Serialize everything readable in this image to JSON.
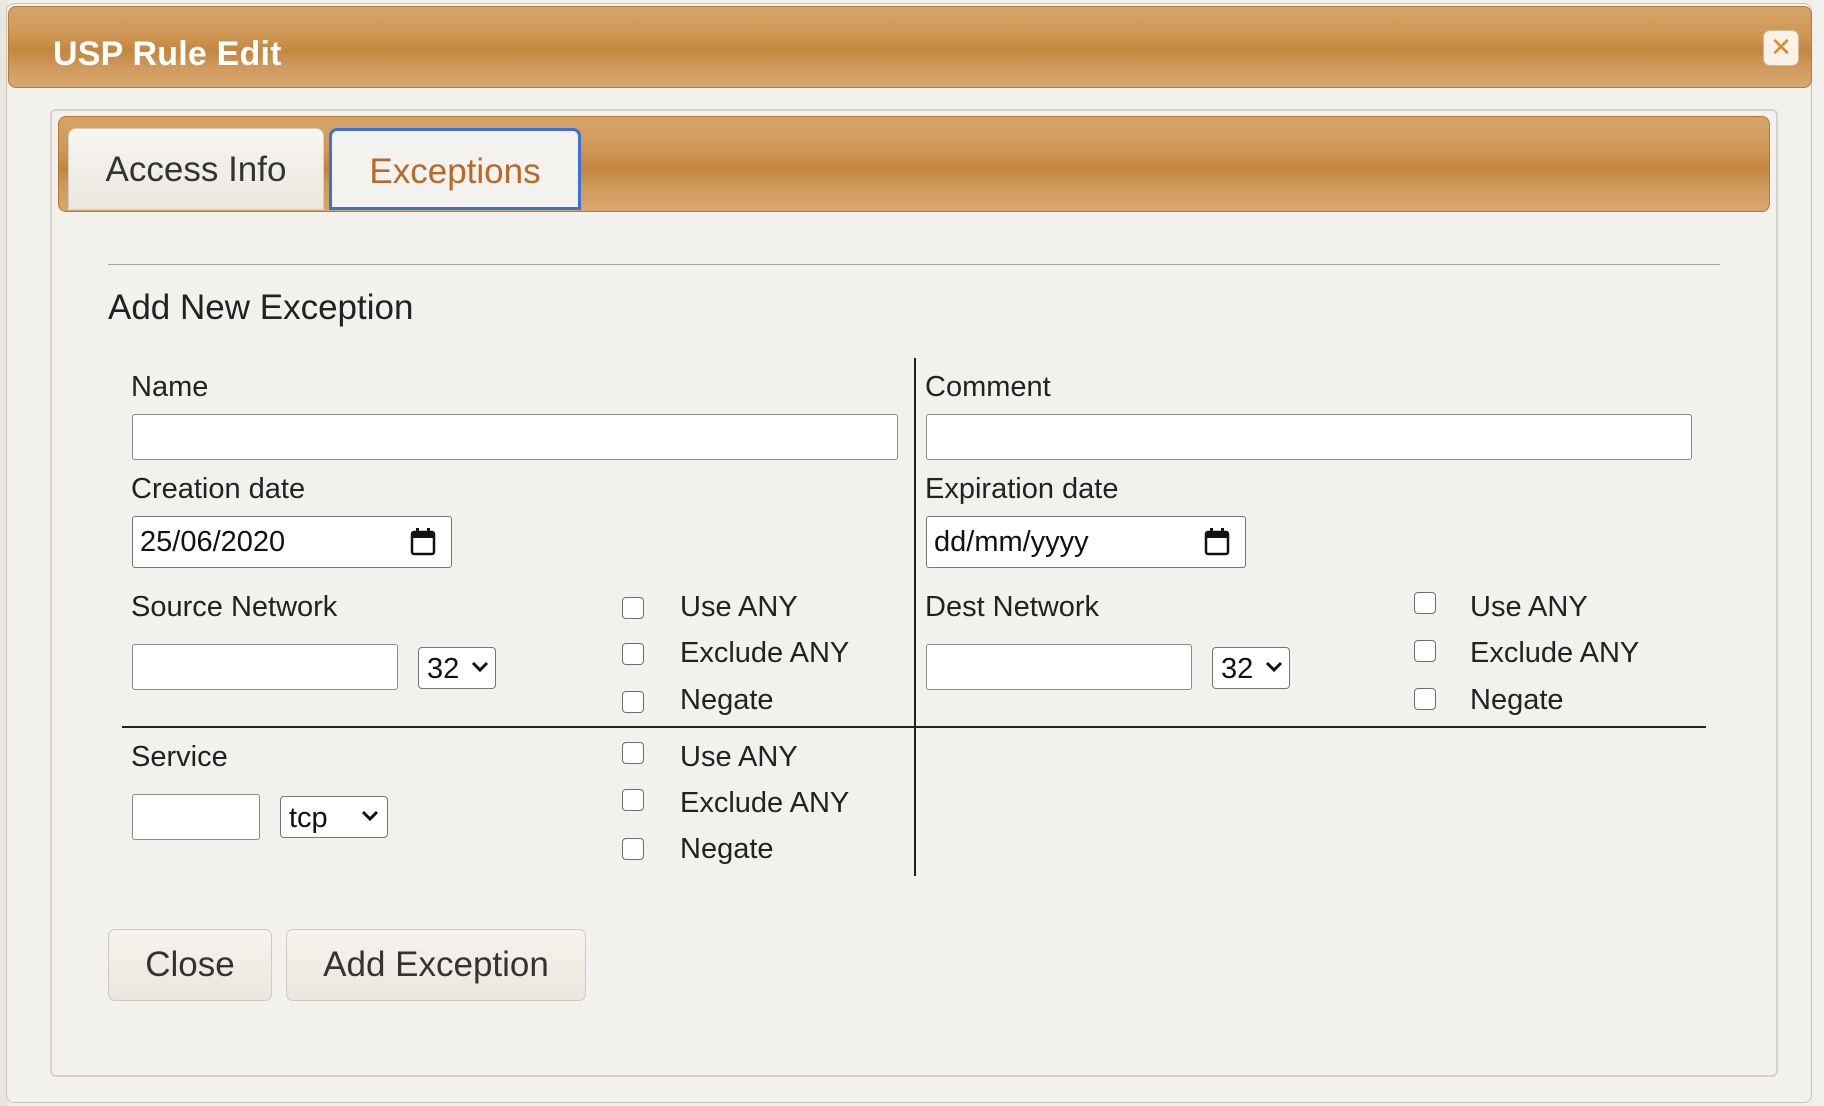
{
  "dialog": {
    "title": "USP Rule Edit",
    "close_icon": "close-x-icon",
    "accent_color": "#c88a45"
  },
  "tabs": [
    {
      "label": "Access Info",
      "active": false
    },
    {
      "label": "Exceptions",
      "active": true
    }
  ],
  "section": {
    "heading": "Add New Exception"
  },
  "form": {
    "name_label": "Name",
    "name_value": "",
    "comment_label": "Comment",
    "comment_value": "",
    "creation_date_label": "Creation date",
    "creation_date_value": "25/06/2020",
    "expiration_date_label": "Expiration date",
    "expiration_date_value": "dd/mm/yyyy",
    "source_network_label": "Source Network",
    "source_network_value": "",
    "source_mask": "32",
    "dest_network_label": "Dest Network",
    "dest_network_value": "",
    "dest_mask": "32",
    "service_label": "Service",
    "service_value": "",
    "service_protocol": "tcp",
    "checkbox_labels": {
      "use_any": "Use ANY",
      "exclude_any": "Exclude ANY",
      "negate": "Negate"
    }
  },
  "buttons": {
    "close": "Close",
    "add_exception": "Add Exception"
  }
}
